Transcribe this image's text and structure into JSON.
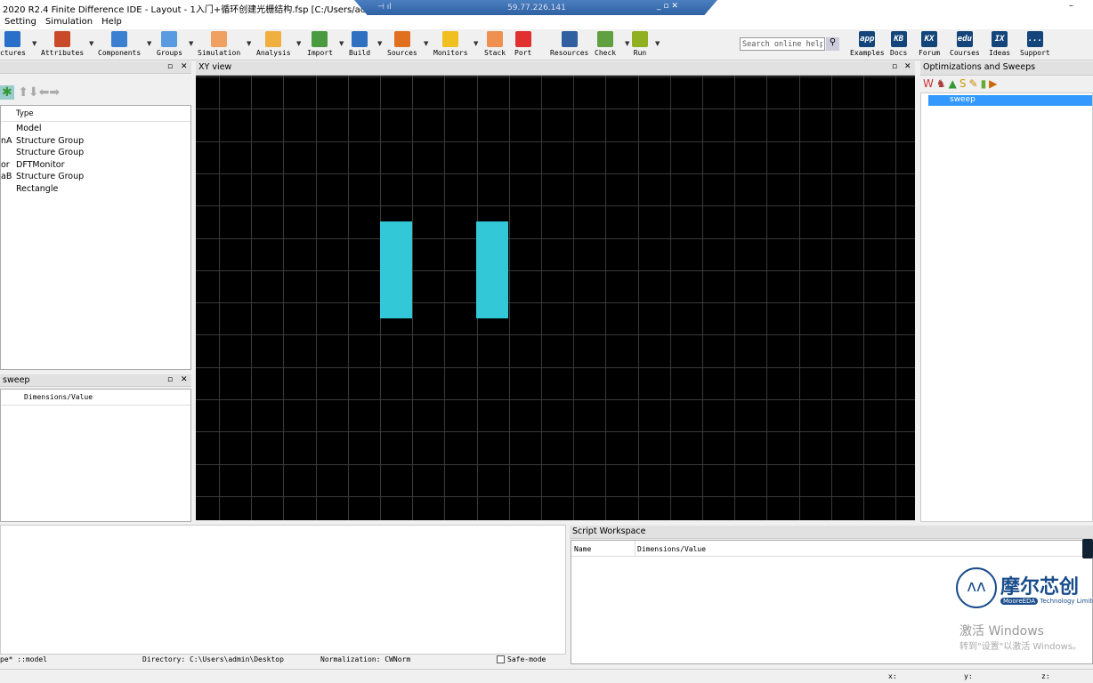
{
  "window": {
    "title": "2020 R2.4 Finite Difference IDE - Layout - 1入门+循环创建光栅结构.fsp [C:/Users/admin/Desktop]",
    "remote_ip": "59.77.226.141",
    "minimize": "–"
  },
  "menu": [
    "Setting",
    "Simulation",
    "Help"
  ],
  "toolbar": [
    {
      "label": "ctures",
      "color": "#2a6fc9"
    },
    {
      "label": "Attributes",
      "color": "#c94a2a"
    },
    {
      "label": "Components",
      "color": "#3a7fd0"
    },
    {
      "label": "Groups",
      "color": "#5a9ae0"
    },
    {
      "label": "Simulation",
      "color": "#f0a060"
    },
    {
      "label": "Analysis",
      "color": "#f0b040"
    },
    {
      "label": "Import",
      "color": "#4a9a40"
    },
    {
      "label": "Build",
      "color": "#3070c0"
    },
    {
      "label": "Sources",
      "color": "#e07020"
    },
    {
      "label": "Monitors",
      "color": "#f0c020"
    },
    {
      "label": "Stack",
      "color": "#f09050"
    },
    {
      "label": "Port",
      "color": "#e03030"
    },
    {
      "label": "Resources",
      "color": "#3060a0"
    },
    {
      "label": "Check",
      "color": "#60a040"
    },
    {
      "label": "Run",
      "color": "#90b020"
    }
  ],
  "search": {
    "placeholder": "Search online help"
  },
  "help_links": [
    {
      "icon": "app",
      "label": "Examples"
    },
    {
      "icon": "KB",
      "label": "Docs"
    },
    {
      "icon": "KX",
      "label": "Forum"
    },
    {
      "icon": "edu",
      "label": "Courses"
    },
    {
      "icon": "IX",
      "label": "Ideas"
    },
    {
      "icon": "...",
      "label": "Support"
    }
  ],
  "objects_tree": {
    "column": "Type",
    "rows": [
      {
        "name": "",
        "type": "Model"
      },
      {
        "name": "nA",
        "type": "Structure Group"
      },
      {
        "name": "",
        "type": "Structure Group"
      },
      {
        "name": "or",
        "type": "DFTMonitor"
      },
      {
        "name": "aB",
        "type": "Structure Group"
      },
      {
        "name": "",
        "type": "Rectangle"
      }
    ]
  },
  "sweep_panel": {
    "title": "sweep",
    "column": "Dimensions/Value"
  },
  "xy_view": {
    "title": "XY view",
    "structure_color": "#33c8d8"
  },
  "optimizations": {
    "title": "Optimizations and Sweeps",
    "items": [
      "sweep"
    ]
  },
  "script_workspace": {
    "title": "Script Workspace",
    "columns": [
      "Name",
      "Dimensions/Value"
    ]
  },
  "status": {
    "type": "pe* ::model",
    "directory": "Directory: C:\\Users\\admin\\Desktop",
    "normalization": "Normalization: CWNorm",
    "safe_mode": "Safe-mode",
    "x": "x:",
    "y": "y:",
    "z": "z:"
  },
  "watermark": {
    "logo_cn": "摩尔芯创",
    "logo_en": "MooreEDA",
    "logo_sub": "Technology Limited",
    "activate": "激活 Windows",
    "activate_sub": "转到\"设置\"以激活 Windows。"
  }
}
